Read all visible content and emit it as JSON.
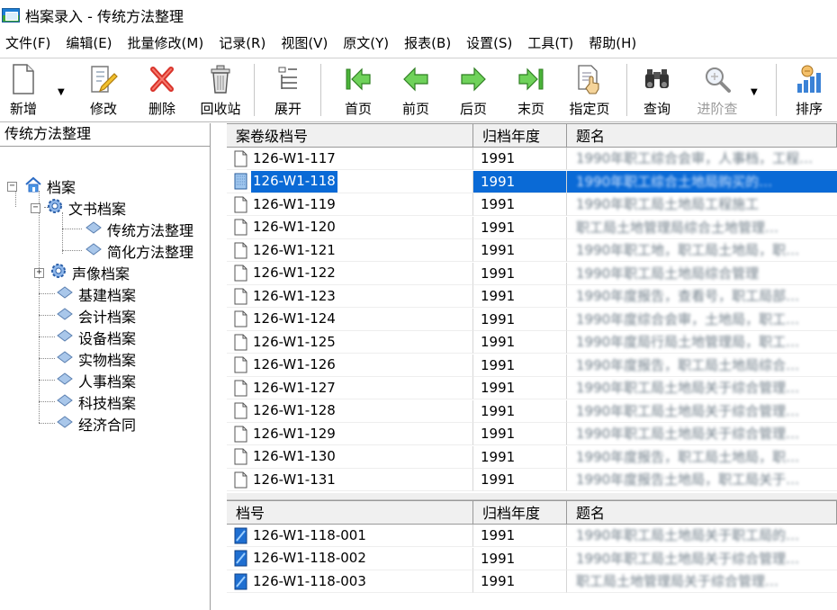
{
  "window": {
    "title": "档案录入 - 传统方法整理"
  },
  "menu": [
    "文件(F)",
    "编辑(E)",
    "批量修改(M)",
    "记录(R)",
    "视图(V)",
    "原文(Y)",
    "报表(B)",
    "设置(S)",
    "工具(T)",
    "帮助(H)"
  ],
  "toolbar": {
    "new": "新增",
    "edit": "修改",
    "delete": "删除",
    "recycle": "回收站",
    "expand": "展开",
    "first": "首页",
    "prev": "前页",
    "next": "后页",
    "last": "末页",
    "goto": "指定页",
    "query": "查询",
    "advanced_query": "进阶查",
    "sort": "排序"
  },
  "left_panel": {
    "title": "传统方法整理",
    "tree": {
      "root": "档案",
      "wenshu": "文书档案",
      "chuantong": "传统方法整理",
      "jianhua": "简化方法整理",
      "shengxiang": "声像档案",
      "jijian": "基建档案",
      "kuaiji": "会计档案",
      "shebei": "设备档案",
      "shiwu": "实物档案",
      "renshi": "人事档案",
      "keji": "科技档案",
      "jingji": "经济合同"
    }
  },
  "top_grid": {
    "columns": [
      "案卷级档号",
      "归档年度",
      "题名"
    ],
    "rows": [
      {
        "id": "126-W1-117",
        "year": "1991",
        "title": "1990年职工综合会审，人事档，工程…"
      },
      {
        "id": "126-W1-118",
        "year": "1991",
        "title": "1990年职工综合土地局购买的…"
      },
      {
        "id": "126-W1-119",
        "year": "1991",
        "title": "1990年职工局土地局工程施工"
      },
      {
        "id": "126-W1-120",
        "year": "1991",
        "title": "职工局土地管理局综合土地管理…"
      },
      {
        "id": "126-W1-121",
        "year": "1991",
        "title": "1990年职工地，职工局土地局，职…"
      },
      {
        "id": "126-W1-122",
        "year": "1991",
        "title": "1990年职工局土地局综合管理"
      },
      {
        "id": "126-W1-123",
        "year": "1991",
        "title": "1990年度报告，查看号，职工局部…"
      },
      {
        "id": "126-W1-124",
        "year": "1991",
        "title": "1990年度综合会审，土地局，职工…"
      },
      {
        "id": "126-W1-125",
        "year": "1991",
        "title": "1990年度局行局土地管理局，职工…"
      },
      {
        "id": "126-W1-126",
        "year": "1991",
        "title": "1990年度报告，职工局土地局综合…"
      },
      {
        "id": "126-W1-127",
        "year": "1991",
        "title": "1990年职工局土地局关于综合管理…"
      },
      {
        "id": "126-W1-128",
        "year": "1991",
        "title": "1990年职工局土地局关于综合管理…"
      },
      {
        "id": "126-W1-129",
        "year": "1991",
        "title": "1990年职工局土地局关于综合管理…"
      },
      {
        "id": "126-W1-130",
        "year": "1991",
        "title": "1990年度报告，职工局土地局，职…"
      },
      {
        "id": "126-W1-131",
        "year": "1991",
        "title": "1990年度报告土地局，职工局关于…"
      }
    ]
  },
  "bottom_grid": {
    "columns": [
      "档号",
      "归档年度",
      "题名"
    ],
    "rows": [
      {
        "id": "126-W1-118-001",
        "year": "1991",
        "title": "1990年职工局土地局关于职工局的…"
      },
      {
        "id": "126-W1-118-002",
        "year": "1991",
        "title": "1990年职工局土地局关于综合管理…"
      },
      {
        "id": "126-W1-118-003",
        "year": "1991",
        "title": "职工局土地管理局关于综合管理…"
      }
    ]
  },
  "colors": {
    "selection": "#0a6ad6",
    "toolbar_green": "#4bb33a"
  }
}
